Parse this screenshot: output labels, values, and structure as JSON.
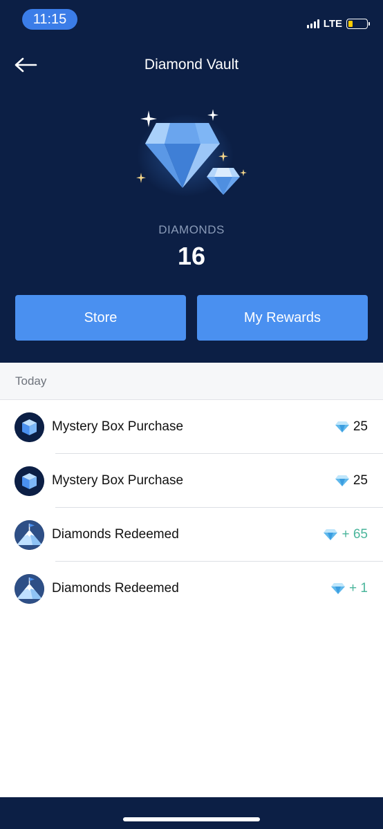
{
  "status_bar": {
    "time": "11:15",
    "network": "LTE",
    "battery_icon": "battery-low-icon",
    "signal_icon": "signal-bars-icon"
  },
  "nav": {
    "title": "Diamond Vault",
    "back_icon": "back-arrow-icon"
  },
  "balance": {
    "label": "DIAMONDS",
    "count": "16",
    "hero_icon": "diamonds-sparkle-icon"
  },
  "actions": {
    "store_label": "Store",
    "rewards_label": "My Rewards"
  },
  "history": {
    "section_title": "Today",
    "items": [
      {
        "label": "Mystery Box Purchase",
        "amount": "25",
        "icon": "mystery-box-icon",
        "amount_icon": "diamond-icon",
        "type": "purchase"
      },
      {
        "label": "Mystery Box Purchase",
        "amount": "25",
        "icon": "mystery-box-icon",
        "amount_icon": "diamond-icon",
        "type": "purchase"
      },
      {
        "label": "Diamonds Redeemed",
        "amount": "+ 65",
        "icon": "mountain-flag-icon",
        "amount_icon": "diamond-icon",
        "type": "redeemed"
      },
      {
        "label": "Diamonds Redeemed",
        "amount": "+ 1",
        "icon": "mountain-flag-icon",
        "amount_icon": "diamond-icon",
        "type": "redeemed"
      }
    ]
  },
  "colors": {
    "header_bg": "#0c1f45",
    "button_bg": "#4a90f0",
    "positive_amount": "#4ab59b",
    "time_pill": "#3b7de8"
  }
}
